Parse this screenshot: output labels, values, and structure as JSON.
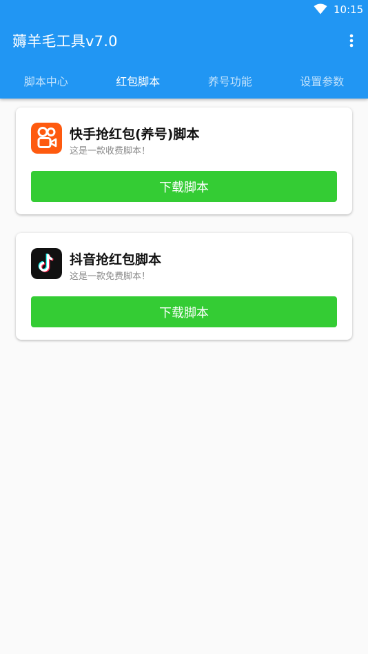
{
  "status_bar": {
    "time": "10:15",
    "wifi_icon": "wifi-icon"
  },
  "app_bar": {
    "title": "薅羊毛工具v7.0",
    "menu_icon": "more-vert-icon"
  },
  "tabs": [
    {
      "label": "脚本中心",
      "active": false
    },
    {
      "label": "红包脚本",
      "active": true
    },
    {
      "label": "养号功能",
      "active": false
    },
    {
      "label": "设置参数",
      "active": false
    }
  ],
  "scripts": [
    {
      "icon": "kuaishou-icon",
      "title": "快手抢红包(养号)脚本",
      "subtitle": "这是一款收费脚本！",
      "button_label": "下载脚本"
    },
    {
      "icon": "douyin-icon",
      "title": "抖音抢红包脚本",
      "subtitle": "这是一款免费脚本！",
      "button_label": "下载脚本"
    }
  ],
  "colors": {
    "primary": "#2196f3",
    "button": "#34cc34",
    "background": "#fafafa"
  }
}
